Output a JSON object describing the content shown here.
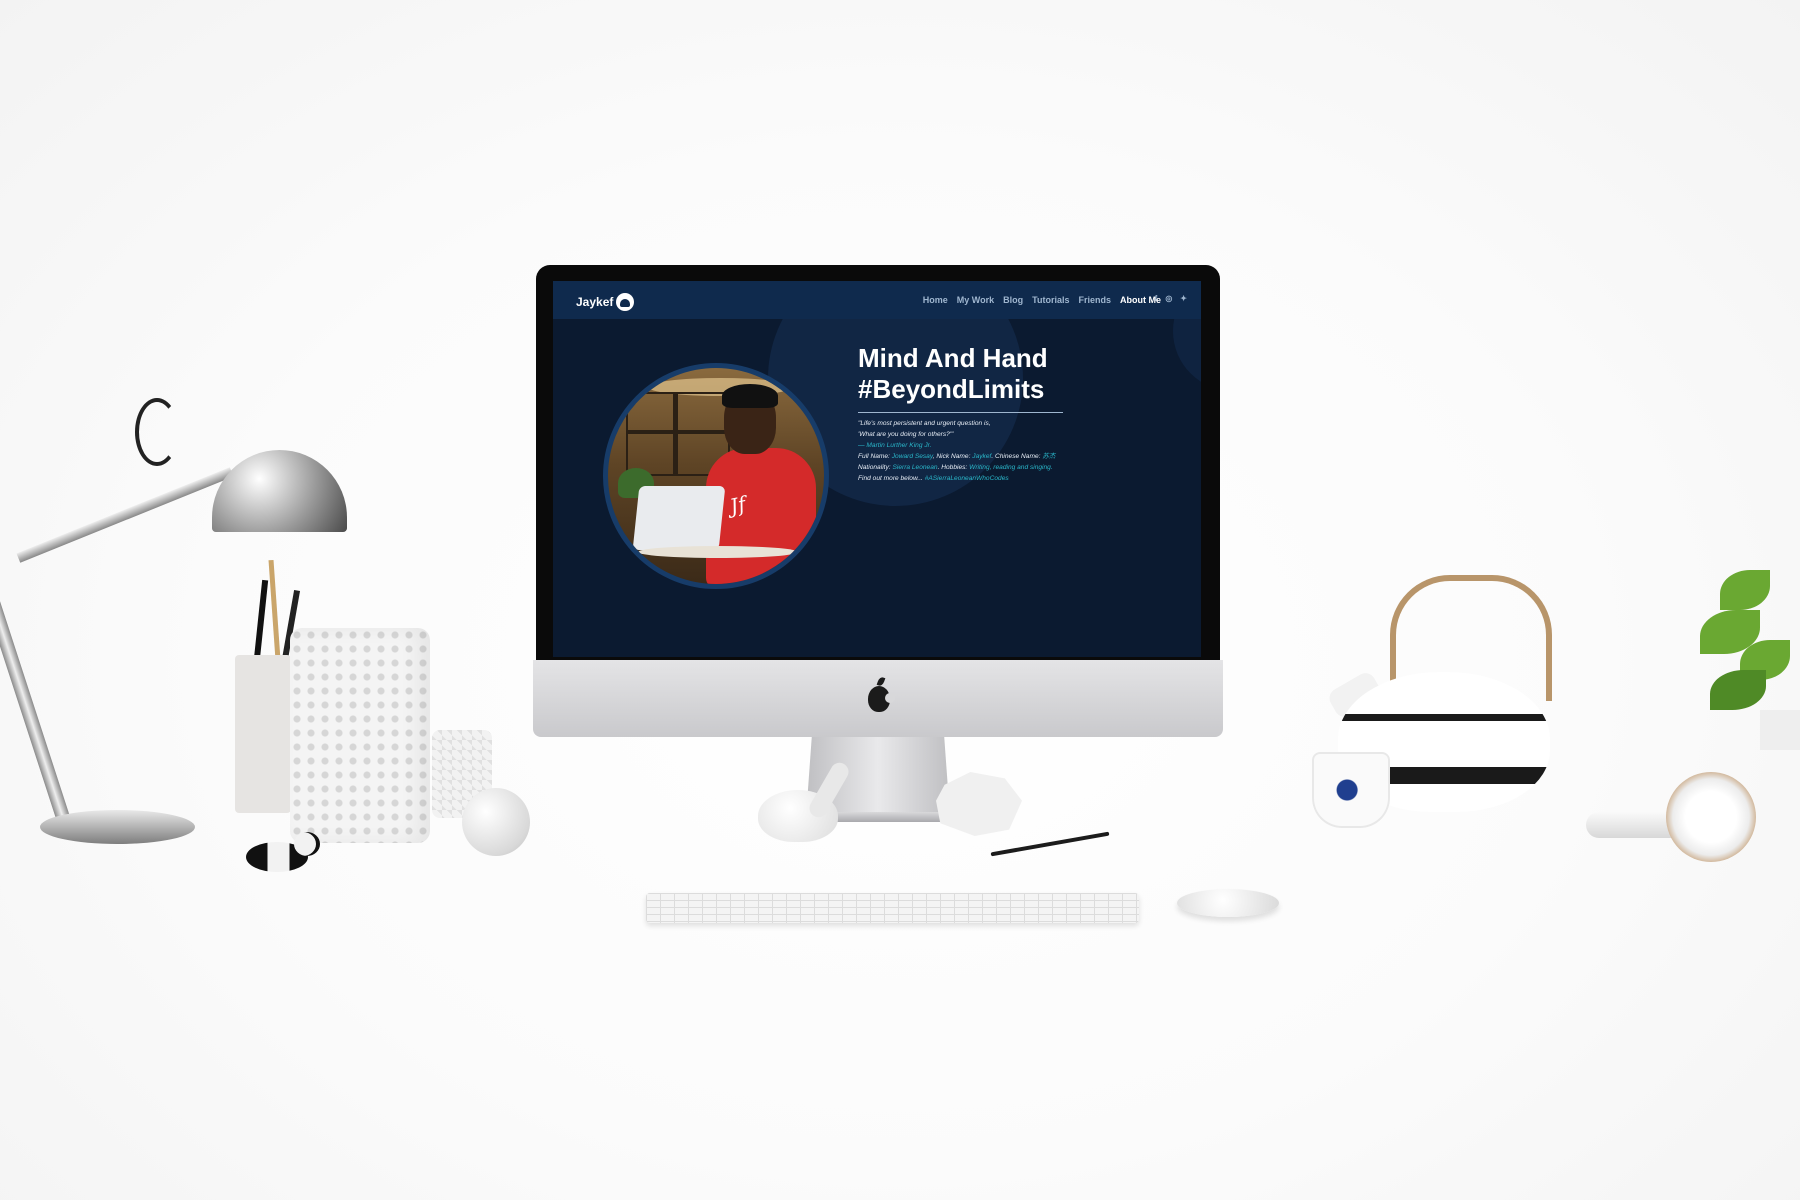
{
  "site": {
    "brand": "Jaykef",
    "nav": {
      "links": [
        "Home",
        "My Work",
        "Blog",
        "Tutorials",
        "Friends",
        "About Me"
      ],
      "active_index": 5,
      "social_icons": [
        "facebook-icon",
        "instagram-icon",
        "twitter-icon"
      ]
    },
    "hero": {
      "title_line1": "Mind And Hand",
      "title_line2": "#BeyondLimits",
      "quote_line1": "\"Life's most persistent and urgent question is,",
      "quote_line2": "'What are you doing for others?'\"",
      "quote_author": "— Martin Lurther King Jr.",
      "full_name_label": "Full Name:",
      "full_name": "Joward Sesay",
      "nick_name_label": ", Nick Name:",
      "nick_name": "Jaykef",
      "chinese_name_label": ". Chinese Name:",
      "chinese_name": "苏杰",
      "nationality_label": "Nationality:",
      "nationality": "Sierra Leonean",
      "hobbies_label": ". Hobbies:",
      "hobbies": "Writing, reading and singing.",
      "find_more": "Find out more below...",
      "hashtag": "#ASierraLeoneanWhoCodes"
    }
  },
  "colors": {
    "nav_bg": "#0f2a4d",
    "page_bg": "#0b1a30",
    "accent": "#2ab7ca"
  }
}
